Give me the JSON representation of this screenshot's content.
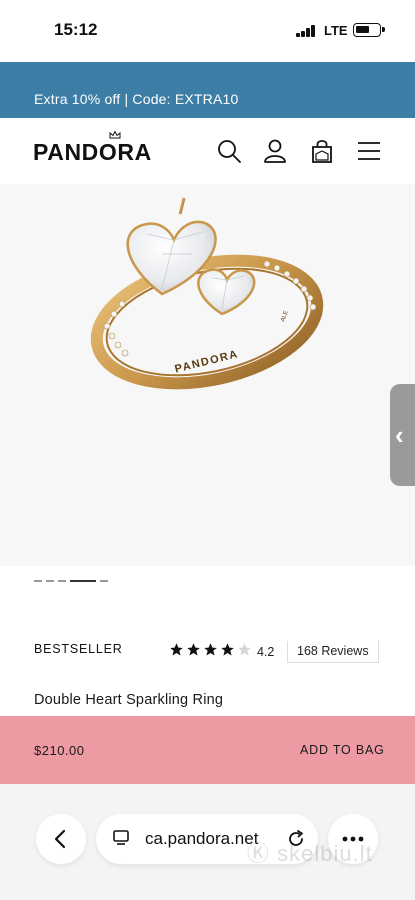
{
  "status_bar": {
    "time": "15:12",
    "network": "LTE"
  },
  "promo": {
    "text": "Extra 10% off | Code: EXTRA10"
  },
  "header": {
    "logo": "PANDORA",
    "icons": [
      "search-icon",
      "account-icon",
      "bag-icon",
      "menu-icon"
    ]
  },
  "gallery": {
    "ring_engraving": "PANDORA",
    "ring_inner_mark": "ALE",
    "image_count": 5,
    "active_index": 3
  },
  "product": {
    "badge": "BESTSELLER",
    "rating": "4.2",
    "rating_value": 4.2,
    "reviews": "168 Reviews",
    "name": "Double Heart Sparkling Ring"
  },
  "sticky_bar": {
    "price": "$210.00",
    "add_to_bag": "ADD TO BAG"
  },
  "browser": {
    "url": "ca.pandora.net",
    "watermark": "Ⓚ skelbiu.lt"
  },
  "colors": {
    "promo_bg": "#3d7ea6",
    "sticky_bg": "#ee9aa3",
    "gold": "#c9964a"
  }
}
